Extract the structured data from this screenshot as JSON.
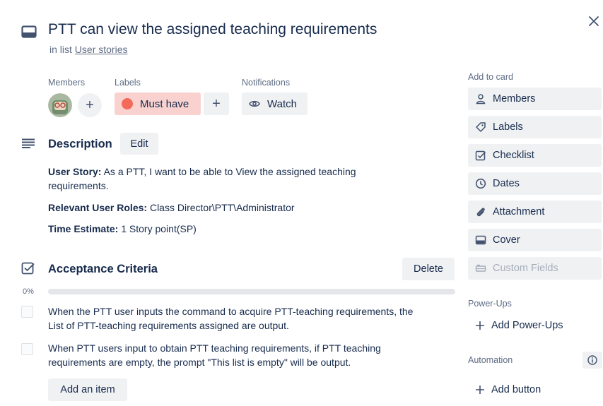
{
  "card": {
    "title": "PTT can view the assigned teaching requirements",
    "in_list_prefix": "in list",
    "list_name": "User stories"
  },
  "meta": {
    "members_label": "Members",
    "labels_label": "Labels",
    "notifications_label": "Notifications",
    "label_name": "Must have",
    "label_color": "#f36a5b",
    "watch_label": "Watch",
    "add_symbol": "+"
  },
  "description": {
    "title": "Description",
    "edit_label": "Edit",
    "paragraphs": [
      {
        "bold": "User Story:",
        "text": " As a PTT, I want to be able to View the assigned teaching requirements."
      },
      {
        "bold": "Relevant User Roles:",
        "text": " Class Director\\PTT\\Administrator"
      },
      {
        "bold": "Time Estimate:",
        "text": " 1 Story point(SP)"
      }
    ]
  },
  "checklist": {
    "title": "Acceptance Criteria",
    "delete_label": "Delete",
    "percent": "0%",
    "progress": 0,
    "items": [
      "When the PTT user inputs the command to acquire PTT-teaching requirements, the List of PTT-teaching requirements assigned are output.",
      "When PTT users input to obtain PTT teaching requirements, if PTT teaching requirements are empty, the prompt \"This list is empty\" will be output."
    ],
    "add_item_label": "Add an item"
  },
  "sidebar": {
    "add_to_card_label": "Add to card",
    "buttons": [
      {
        "label": "Members",
        "icon": "person-icon"
      },
      {
        "label": "Labels",
        "icon": "tag-icon"
      },
      {
        "label": "Checklist",
        "icon": "checklist-icon"
      },
      {
        "label": "Dates",
        "icon": "clock-icon"
      },
      {
        "label": "Attachment",
        "icon": "paperclip-icon"
      },
      {
        "label": "Cover",
        "icon": "cover-icon"
      },
      {
        "label": "Custom Fields",
        "icon": "custom-fields-icon"
      }
    ],
    "power_ups_label": "Power-Ups",
    "add_power_ups_label": "Add Power-Ups",
    "automation_label": "Automation",
    "add_button_label": "Add button"
  }
}
